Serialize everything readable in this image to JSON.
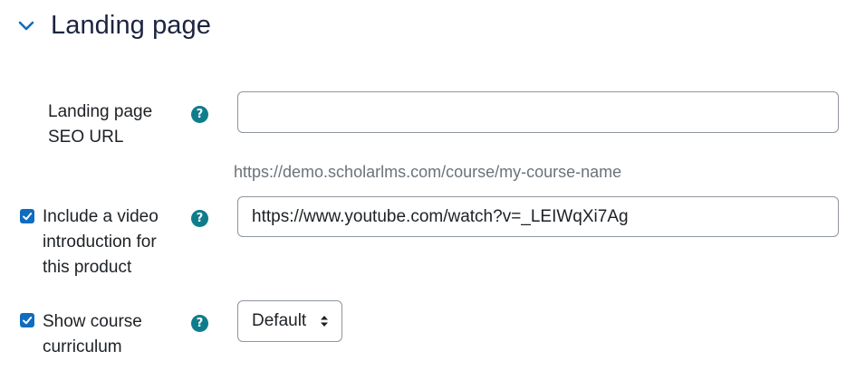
{
  "section": {
    "title": "Landing page",
    "expanded": true,
    "chevron_icon": "chevron-down-icon",
    "accent_color": "#0f6cbf"
  },
  "fields": {
    "seo_url": {
      "label_line1": "Landing page",
      "label_line2": "SEO URL",
      "value": "",
      "hint": "https://demo.scholarlms.com/course/my-course-name",
      "help_icon": "question-icon"
    },
    "video": {
      "checked": true,
      "label_line1": "Include a video",
      "label_line2": "introduction for",
      "label_line3": "this product",
      "value": "https://www.youtube.com/watch?v=_LEIWqXi7Ag",
      "help_icon": "question-icon"
    },
    "curriculum": {
      "checked": true,
      "label_line1": "Show course",
      "label_line2": "curriculum",
      "selected": "Default",
      "help_icon": "question-icon"
    }
  },
  "colors": {
    "help_badge": "#0f7c8c",
    "checkbox": "#0f6cbf",
    "hint_text": "#6a737b",
    "input_border": "#8f959e"
  }
}
